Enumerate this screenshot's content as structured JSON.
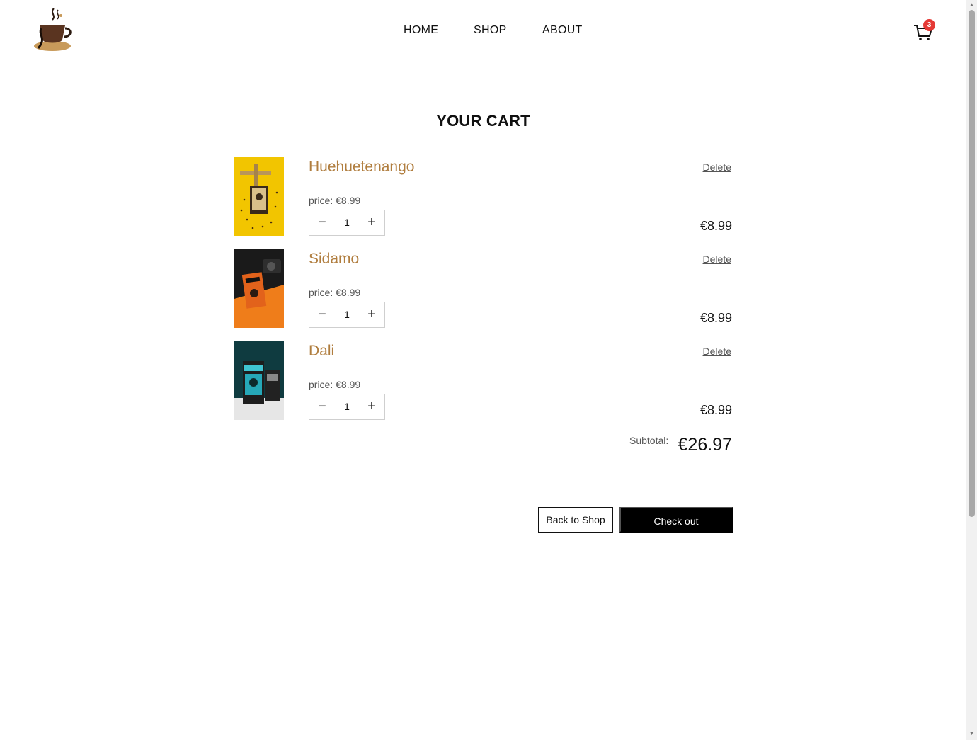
{
  "header": {
    "nav": [
      {
        "label": "HOME"
      },
      {
        "label": "SHOP"
      },
      {
        "label": "ABOUT"
      }
    ],
    "cart_count": "3",
    "cart_icon": "shopping-cart-icon",
    "logo": "coffee-cup-logo"
  },
  "page_title": "YOUR CART",
  "items": [
    {
      "name": "Huehuetenango",
      "delete_label": "Delete",
      "price_label": "price: €8.99",
      "quantity": "1",
      "line_total": "€8.99",
      "image": "yellow-coffee-bag-photo"
    },
    {
      "name": "Sidamo",
      "delete_label": "Delete",
      "price_label": "price: €8.99",
      "quantity": "1",
      "line_total": "€8.99",
      "image": "orange-coffee-bag-photo"
    },
    {
      "name": "Dali",
      "delete_label": "Delete",
      "price_label": "price: €8.99",
      "quantity": "1",
      "line_total": "€8.99",
      "image": "teal-coffee-bag-photo"
    }
  ],
  "subtotal": {
    "label": "Subtotal:",
    "value": "€26.97"
  },
  "actions": {
    "back_label": "Back to Shop",
    "checkout_label": "Check out"
  },
  "colors": {
    "accent": "#b07d3e",
    "badge": "#e53935",
    "primary_button": "#000000"
  }
}
